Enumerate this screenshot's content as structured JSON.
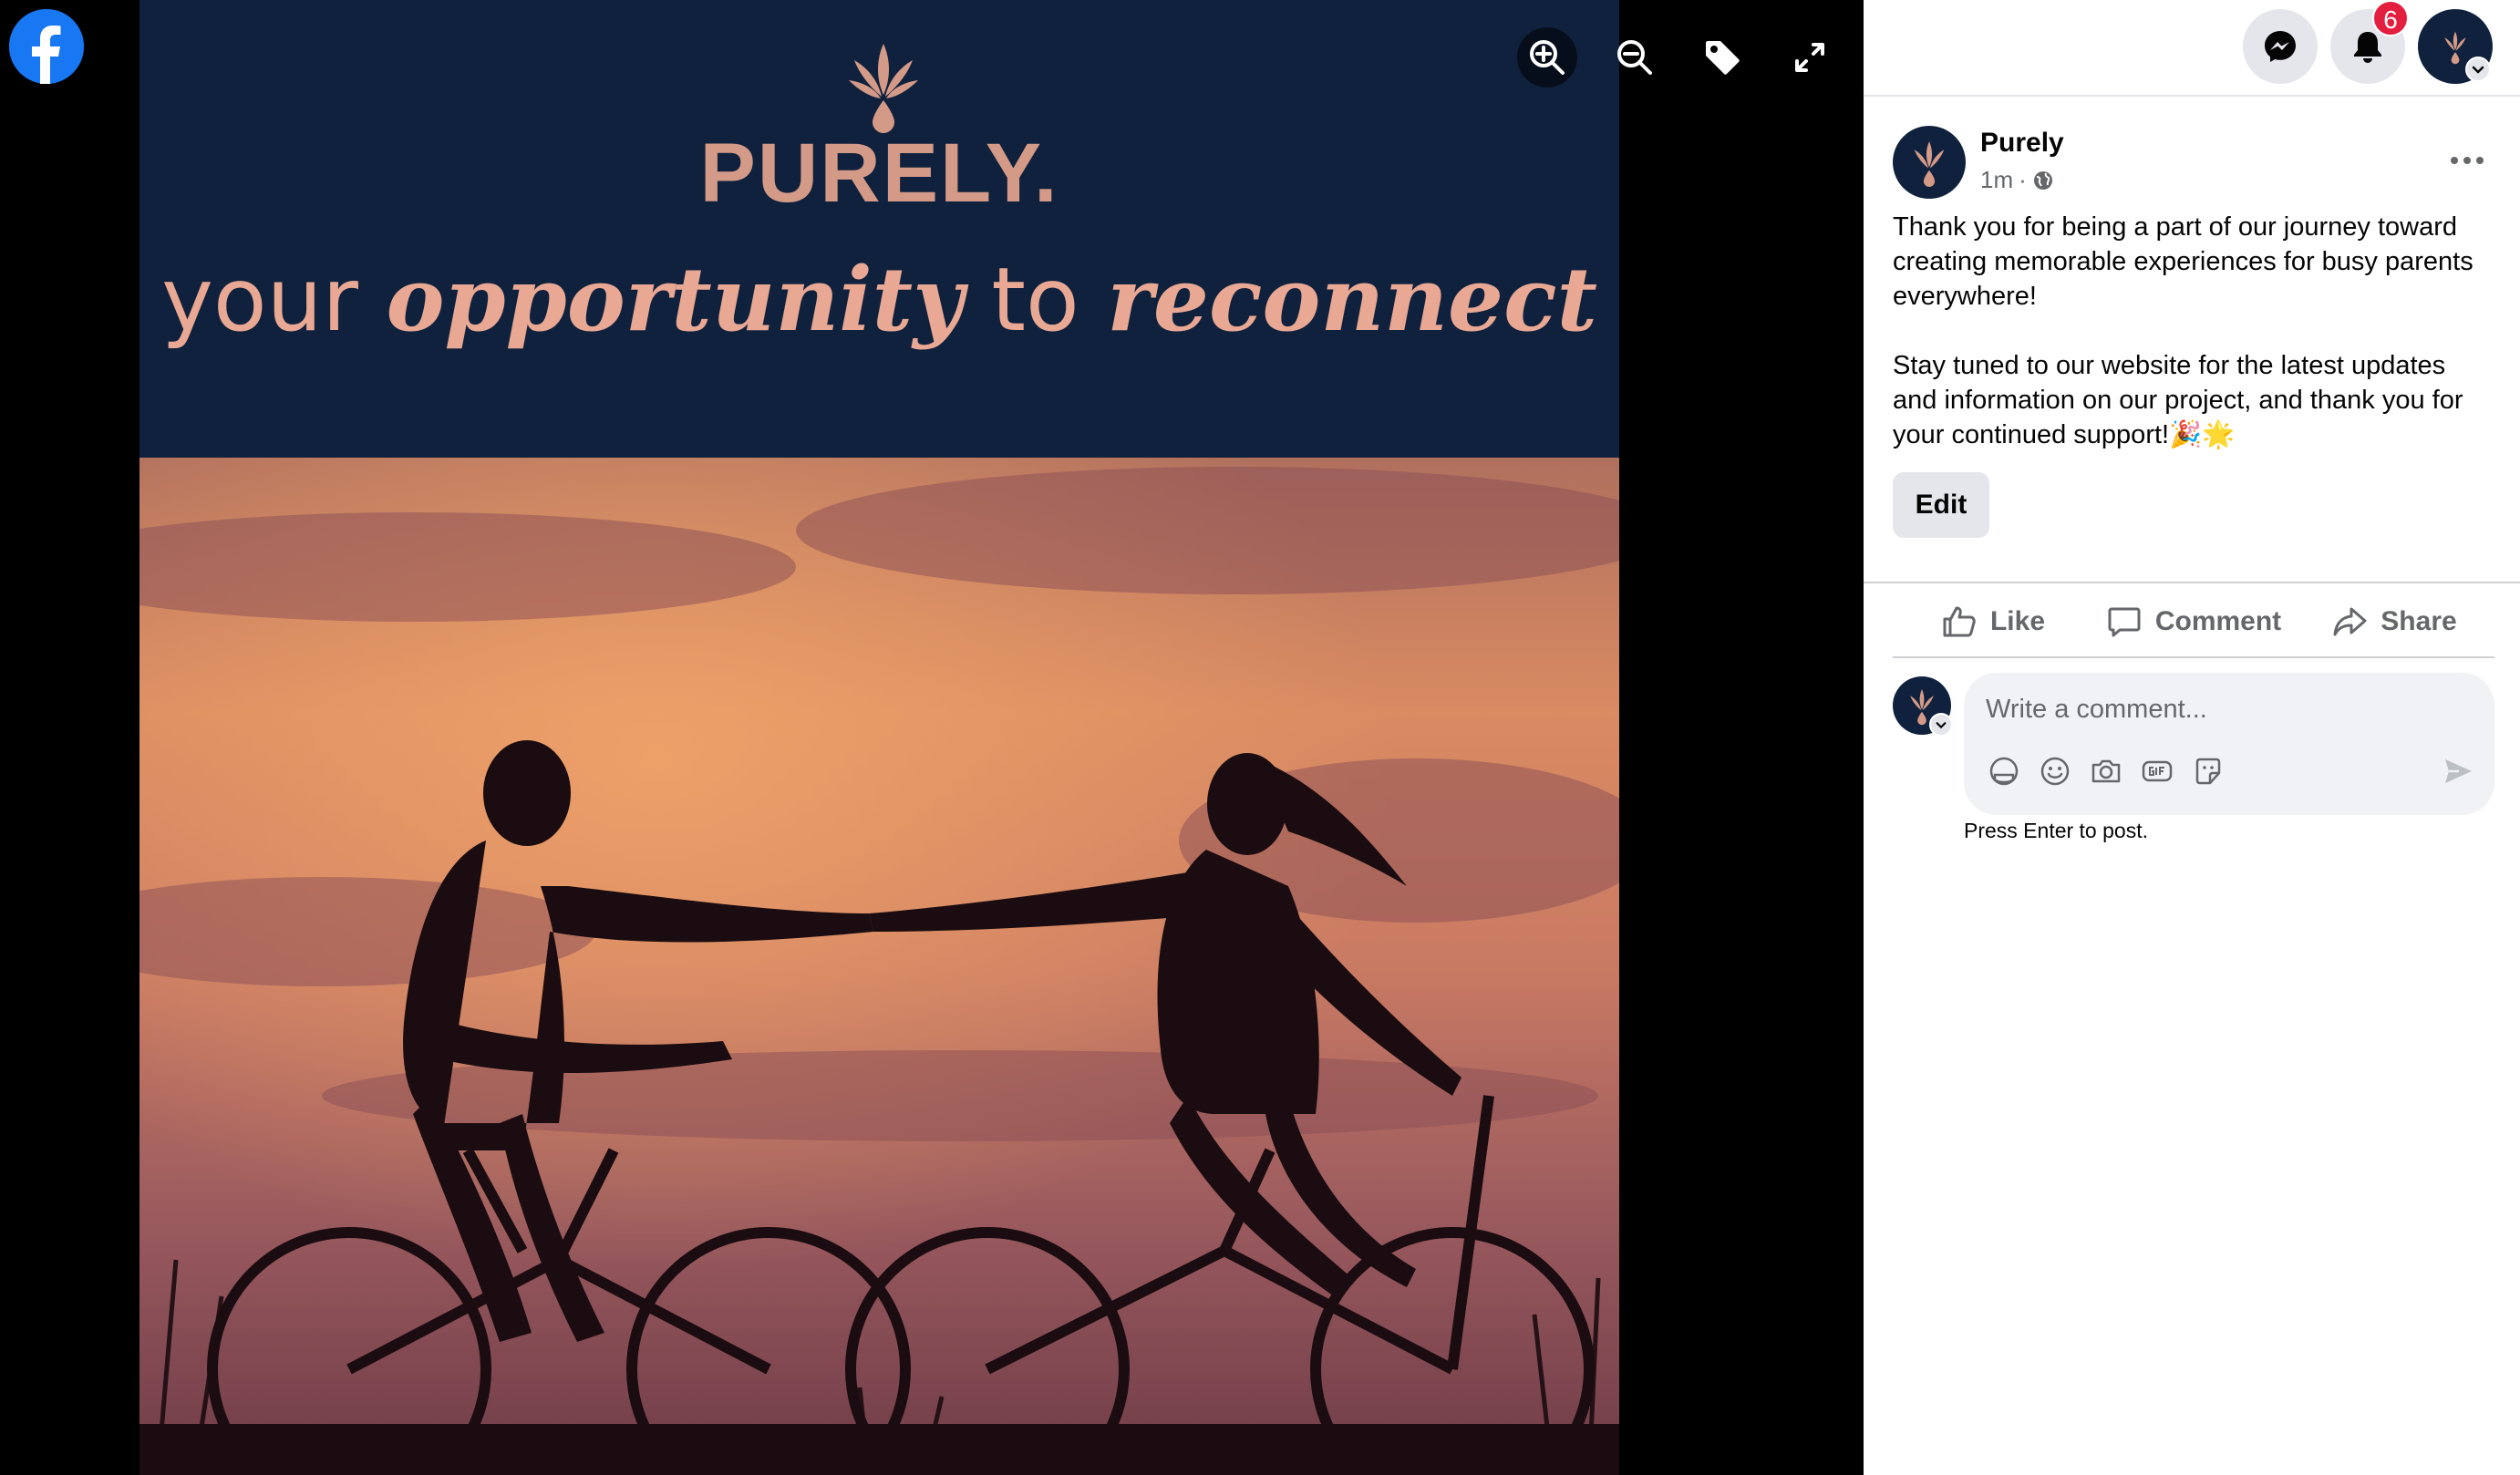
{
  "viewer": {
    "logo_icon": "facebook-logo-icon",
    "controls": [
      "zoom-in-icon",
      "zoom-out-icon",
      "tag-icon",
      "fullscreen-icon"
    ],
    "photo": {
      "brand_name": "PURELY.",
      "tagline_1": "your ",
      "tagline_2": "opportunity",
      "tagline_3": " to ",
      "tagline_4": "reconnect",
      "banner_color": "#10213d",
      "brand_color": "#d39a88"
    }
  },
  "topbar": {
    "messenger_icon": "messenger-icon",
    "notifications_icon": "bell-icon",
    "notification_count": "6",
    "account_icon": "purely-logo-icon"
  },
  "post": {
    "author": "Purely",
    "time": "1m",
    "separator": "·",
    "audience_icon": "globe-icon",
    "paragraph_1": "Thank you for being a part of our journey toward creating memorable experiences for busy parents everywhere!",
    "paragraph_2": "Stay tuned to our website for the latest updates and information on our project, and thank you for your continued support!🎉🌟",
    "edit_label": "Edit"
  },
  "actions": {
    "like": "Like",
    "comment": "Comment",
    "share": "Share"
  },
  "comment": {
    "placeholder": "Write a comment...",
    "hint": "Press Enter to post.",
    "tools": [
      "avatar-sticker-icon",
      "emoji-icon",
      "camera-icon",
      "gif-icon",
      "sticker-icon"
    ]
  },
  "colors": {
    "facebook_blue": "#1877f2",
    "badge_red": "#e41e3f",
    "panel_bg": "#ffffff",
    "input_bg": "#f0f2f5"
  }
}
